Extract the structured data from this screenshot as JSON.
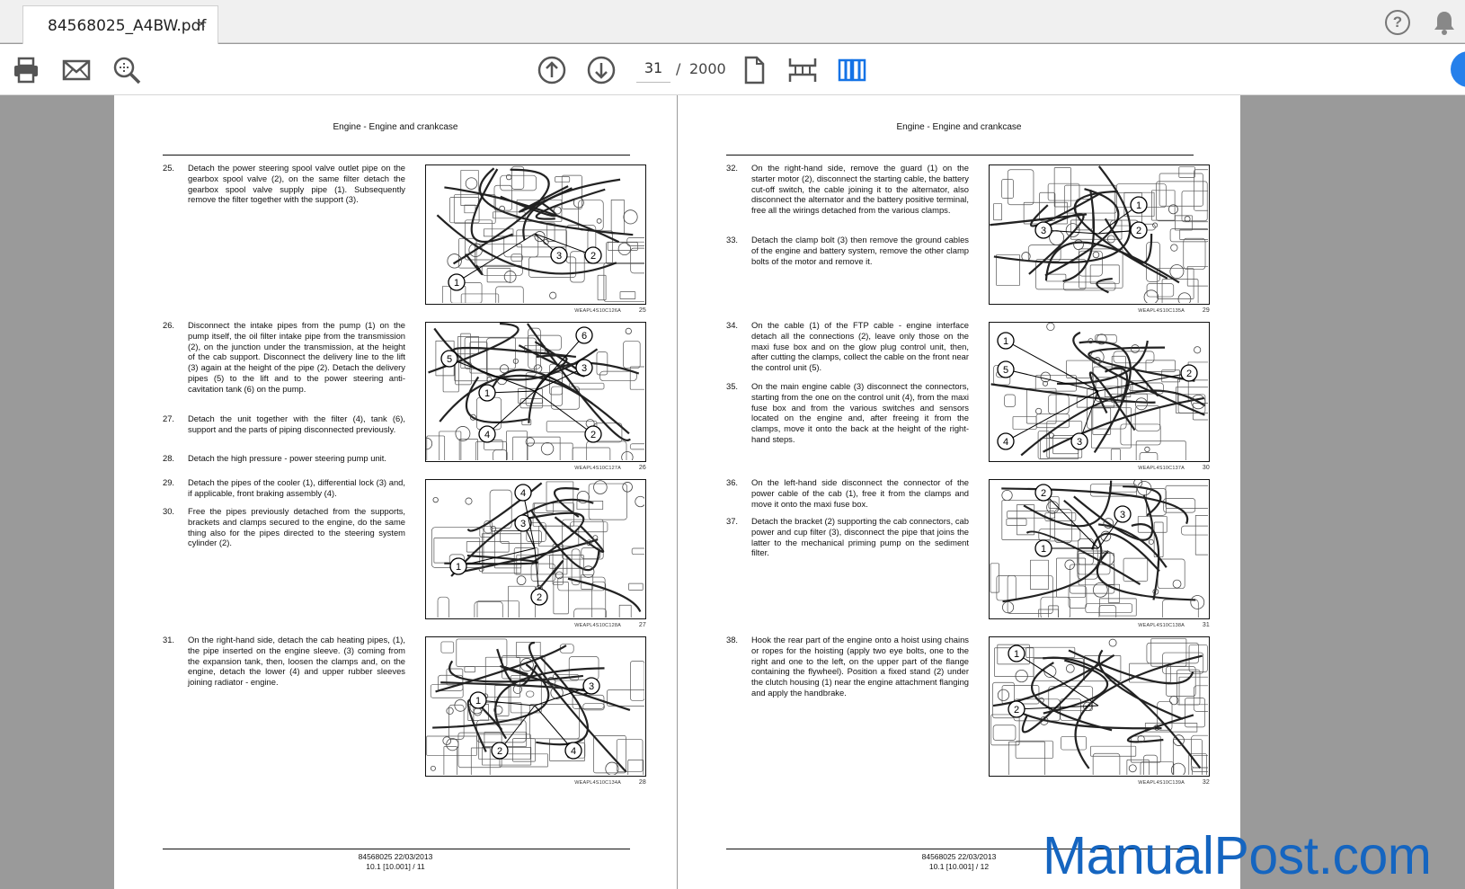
{
  "tab": {
    "title": "84568025_A4BW.pdf",
    "close": "×"
  },
  "icons": {
    "help": "help-icon",
    "bell": "bell-icon",
    "print": "print-icon",
    "mail": "mail-icon",
    "zoom": "zoom-icon",
    "prev": "arrow-up-icon",
    "next": "arrow-down-icon",
    "single_page": "single-page-icon",
    "scroll": "scroll-mode-icon",
    "two_page": "two-page-icon"
  },
  "help_glyph": "?",
  "nav": {
    "current_page": "31",
    "separator": "/",
    "total_pages": "2000"
  },
  "colors": {
    "accent": "#2680eb",
    "watermark": "#1565c0",
    "background": "#9a9a9a"
  },
  "left_page": {
    "header": "Engine - Engine and crankcase",
    "steps": [
      {
        "num": "25.",
        "text": "Detach the power steering spool valve outlet pipe on the gearbox spool valve (2), on the same filter detach the gearbox spool valve supply pipe (1). Subsequently remove the filter together with the support (3)."
      },
      {
        "num": "26.",
        "text": "Disconnect the intake pipes from the pump (1) on the pump itself, the oil filter intake pipe from the transmission (2), on the junction under the transmission, at the height of the cab support. Disconnect the delivery line to the lift (3) again at the height of the pipe (2). Detach the delivery pipes (5) to the lift and to the power steering anti-cavitation tank (6) on the pump."
      },
      {
        "num": "27.",
        "text": "Detach the unit together with the filter (4), tank (6), support and the parts of piping disconnected previously."
      },
      {
        "num": "28.",
        "text": "Detach the high pressure - power steering pump unit."
      },
      {
        "num": "29.",
        "text": "Detach the pipes of the cooler (1), differential lock (3) and, if applicable, front braking assembly (4)."
      },
      {
        "num": "30.",
        "text": "Free the pipes previously detached from the supports, brackets and clamps secured to the engine, do the same thing also for the pipes directed to the steering system cylinder (2)."
      },
      {
        "num": "31.",
        "text": "On the right-hand side, detach the cab heating pipes, (1), the pipe inserted on the engine sleeve. (3) coming from the expansion tank, then, loosen the clamps and, on the engine, detach the lower (4) and upper rubber sleeves joining radiator - engine."
      }
    ],
    "figures": [
      {
        "code": "WEAPL4S10C126A",
        "num": "25",
        "callouts": [
          "1",
          "2",
          "3"
        ]
      },
      {
        "code": "WEAPL4S10C127A",
        "num": "26",
        "callouts": [
          "1",
          "2",
          "3",
          "4",
          "5",
          "6"
        ]
      },
      {
        "code": "WEAPL4S10C128A",
        "num": "27",
        "callouts": [
          "1",
          "2",
          "3",
          "4"
        ]
      },
      {
        "code": "WEAPL4S10C134A",
        "num": "28",
        "callouts": [
          "1",
          "2",
          "3",
          "4"
        ]
      }
    ],
    "footer_line1": "84568025 22/03/2013",
    "footer_line2": "10.1 [10.001] / 11"
  },
  "right_page": {
    "header": "Engine - Engine and crankcase",
    "steps": [
      {
        "num": "32.",
        "text": "On the right-hand side, remove the guard (1) on the starter motor (2), disconnect the starting cable, the battery cut-off switch, the cable joining it to the alternator, also disconnect the alternator and the battery positive terminal, free all the wirings detached from the various clamps."
      },
      {
        "num": "33.",
        "text": "Detach the clamp bolt (3) then remove the ground cables of the engine and battery system, remove the other clamp bolts of the motor and remove it."
      },
      {
        "num": "34.",
        "text": "On the cable (1) of the FTP cable - engine interface detach all the connections (2), leave only those on the maxi fuse box and on the glow plug control unit, then, after cutting the clamps, collect the cable on the front near the control unit (5)."
      },
      {
        "num": "35.",
        "text": "On the main engine cable (3) disconnect the connectors, starting from the one on the control unit (4), from the maxi fuse box and from the various switches and sensors located on the engine and, after freeing it from the clamps, move it onto the back at the height of the right-hand steps."
      },
      {
        "num": "36.",
        "text": "On the left-hand side disconnect the connector of the power cable of the cab (1), free it from the clamps and move it onto the maxi fuse box."
      },
      {
        "num": "37.",
        "text": "Detach the bracket (2) supporting the cab connectors, cab power and cup filter (3), disconnect the pipe that joins the latter to the mechanical priming pump on the sediment filter."
      },
      {
        "num": "38.",
        "text": "Hook the rear part of the engine onto a hoist using chains or ropes for the hoisting (apply two eye bolts, one to the right and one to the left, on the upper part of the flange containing the flywheel). Position a fixed stand (2) under the clutch housing (1) near the engine attachment flanging and apply the handbrake."
      }
    ],
    "figures": [
      {
        "code": "WEAPL4S10C135A",
        "num": "29",
        "callouts": [
          "1",
          "2",
          "3"
        ]
      },
      {
        "code": "WEAPL4S10C137A",
        "num": "30",
        "callouts": [
          "1",
          "2",
          "3",
          "4",
          "5"
        ]
      },
      {
        "code": "WEAPL4S10C138A",
        "num": "31",
        "callouts": [
          "1",
          "2",
          "3"
        ]
      },
      {
        "code": "WEAPL4S10C139A",
        "num": "32",
        "callouts": [
          "1",
          "2"
        ]
      }
    ],
    "footer_line1": "84568025 22/03/2013",
    "footer_line2": "10.1 [10.001] / 12"
  },
  "watermark": "ManualPost.com"
}
